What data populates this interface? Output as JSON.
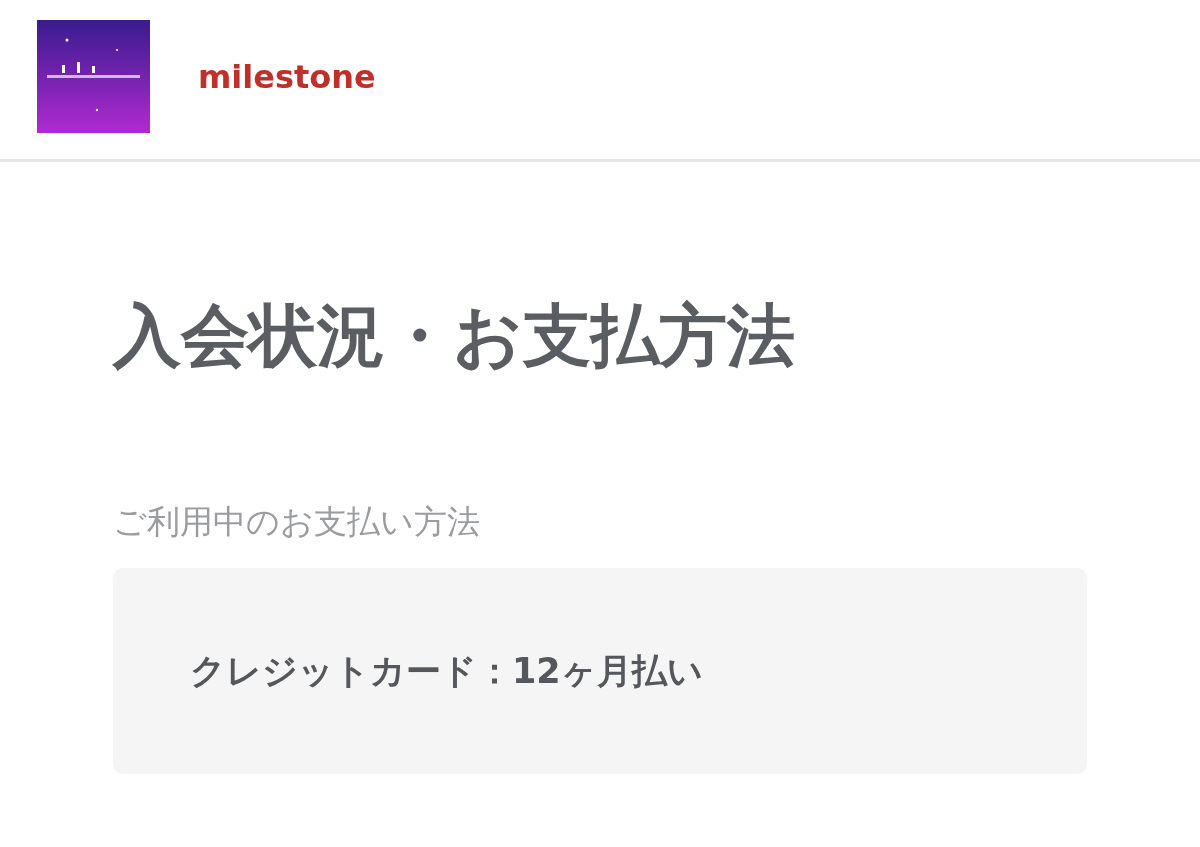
{
  "header": {
    "site_name": "milestone"
  },
  "page_title": "入会状況・お支払方法",
  "section_label": "ご利用中のお支払い方法",
  "payment_card": {
    "text": "クレジットカード：12ヶ月払い"
  }
}
